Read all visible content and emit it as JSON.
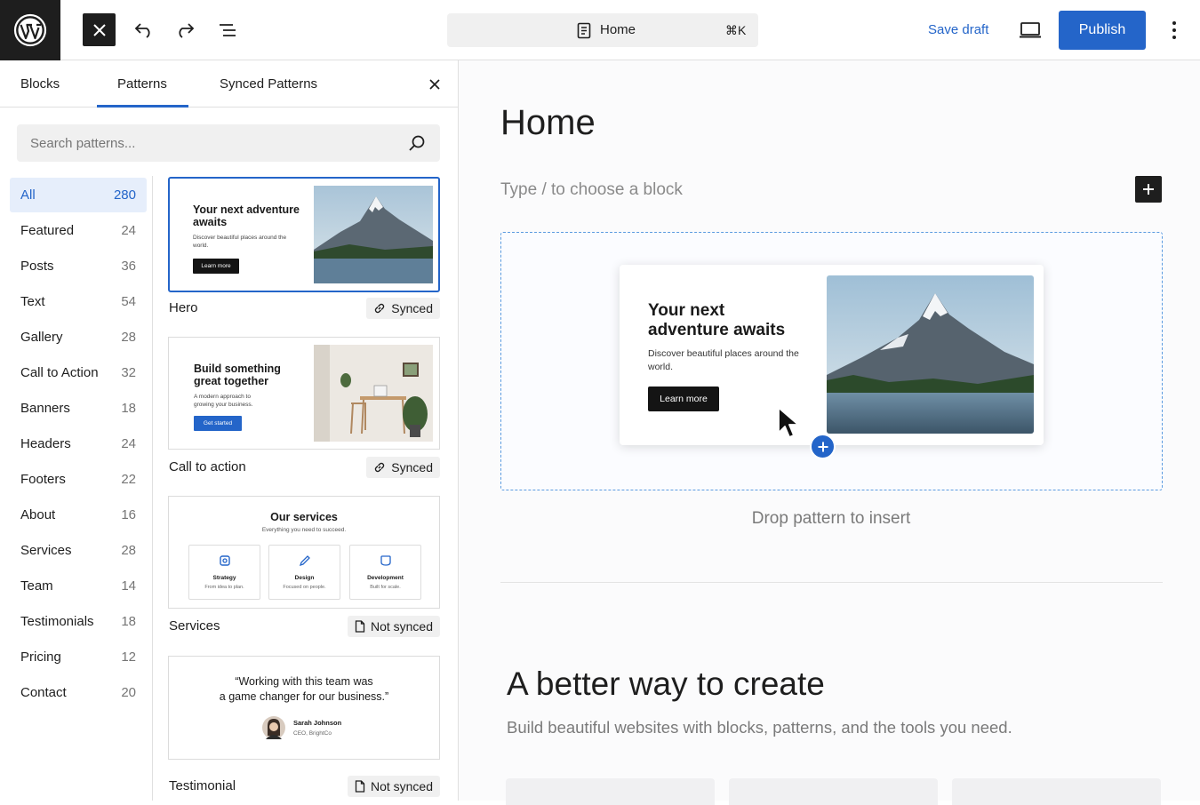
{
  "topbar": {
    "command_title": "Home",
    "command_shortcut": "⌘K",
    "save_draft": "Save draft",
    "publish": "Publish"
  },
  "sidebar": {
    "tabs": [
      {
        "label": "Blocks"
      },
      {
        "label": "Patterns",
        "active": true
      },
      {
        "label": "Synced Patterns"
      }
    ],
    "search_placeholder": "Search patterns...",
    "categories": [
      {
        "label": "All",
        "count": "280",
        "active": true
      },
      {
        "label": "Featured",
        "count": "24"
      },
      {
        "label": "Posts",
        "count": "36"
      },
      {
        "label": "Text",
        "count": "54"
      },
      {
        "label": "Gallery",
        "count": "28"
      },
      {
        "label": "Call to Action",
        "count": "32"
      },
      {
        "label": "Banners",
        "count": "18"
      },
      {
        "label": "Headers",
        "count": "24"
      },
      {
        "label": "Footers",
        "count": "22"
      },
      {
        "label": "About",
        "count": "16"
      },
      {
        "label": "Services",
        "count": "28"
      },
      {
        "label": "Team",
        "count": "14"
      },
      {
        "label": "Testimonials",
        "count": "18"
      },
      {
        "label": "Pricing",
        "count": "12"
      },
      {
        "label": "Contact",
        "count": "20"
      }
    ],
    "patterns": [
      {
        "name": "Hero",
        "status": "Synced",
        "preview": {
          "title": "Your next adventure awaits",
          "subtitle": "Discover beautiful places around the world.",
          "button": "Learn more"
        }
      },
      {
        "name": "Call to action",
        "status": "Synced",
        "preview": {
          "title": "Build something great together",
          "subtitle": "A modern approach to growing your business.",
          "button": "Get started"
        }
      },
      {
        "name": "Services",
        "status": "Not synced",
        "preview": {
          "title": "Our services",
          "subtitle": "Everything you need to succeed.",
          "cards": [
            {
              "title": "Strategy",
              "text": "From idea to plan."
            },
            {
              "title": "Design",
              "text": "Focused on people."
            },
            {
              "title": "Development",
              "text": "Built for scale."
            }
          ]
        }
      },
      {
        "name": "Testimonial",
        "status": "Not synced",
        "preview": {
          "quote_line1": "“Working with this team was",
          "quote_line2": "a game changer for our business.”",
          "person": "Sarah Johnson",
          "role": "CEO, BrightCo"
        }
      }
    ]
  },
  "canvas": {
    "page_title": "Home",
    "block_placeholder": "Type / to choose a block",
    "drop_card": {
      "title": "Your next adventure awaits",
      "subtitle": "Discover beautiful places around the world.",
      "button": "Learn more"
    },
    "drop_hint": "Drop pattern to insert",
    "heading": "A better way to create",
    "lead": "Build beautiful websites with blocks, patterns, and the tools you need."
  },
  "colors": {
    "accent": "#2465c9",
    "dark": "#1e1e1e",
    "muted": "#757575"
  }
}
